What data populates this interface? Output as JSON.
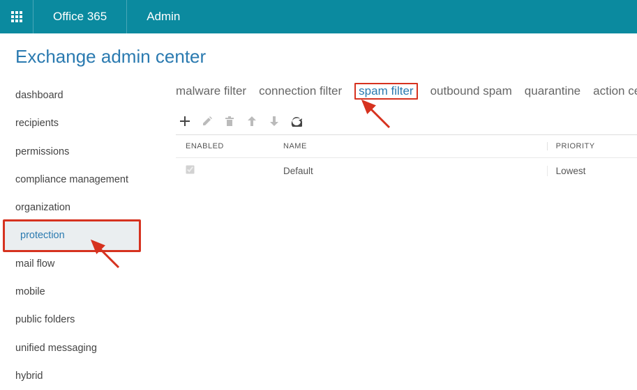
{
  "header": {
    "product": "Office 365",
    "section": "Admin"
  },
  "page_title": "Exchange admin center",
  "sidebar": {
    "items": [
      {
        "label": "dashboard",
        "active": false
      },
      {
        "label": "recipients",
        "active": false
      },
      {
        "label": "permissions",
        "active": false
      },
      {
        "label": "compliance management",
        "active": false
      },
      {
        "label": "organization",
        "active": false
      },
      {
        "label": "protection",
        "active": true
      },
      {
        "label": "mail flow",
        "active": false
      },
      {
        "label": "mobile",
        "active": false
      },
      {
        "label": "public folders",
        "active": false
      },
      {
        "label": "unified messaging",
        "active": false
      },
      {
        "label": "hybrid",
        "active": false
      }
    ]
  },
  "tabs": {
    "items": [
      {
        "label": "malware filter",
        "active": false
      },
      {
        "label": "connection filter",
        "active": false
      },
      {
        "label": "spam filter",
        "active": true
      },
      {
        "label": "outbound spam",
        "active": false
      },
      {
        "label": "quarantine",
        "active": false
      },
      {
        "label": "action cen",
        "active": false
      }
    ]
  },
  "toolbar": {
    "add": "add",
    "edit": "edit",
    "delete": "delete",
    "up": "move up",
    "down": "move down",
    "refresh": "refresh"
  },
  "table": {
    "columns": {
      "enabled": "ENABLED",
      "name": "NAME",
      "priority": "PRIORITY"
    },
    "rows": [
      {
        "enabled": true,
        "name": "Default",
        "priority": "Lowest"
      }
    ]
  },
  "annotation_color": "#d6321f"
}
